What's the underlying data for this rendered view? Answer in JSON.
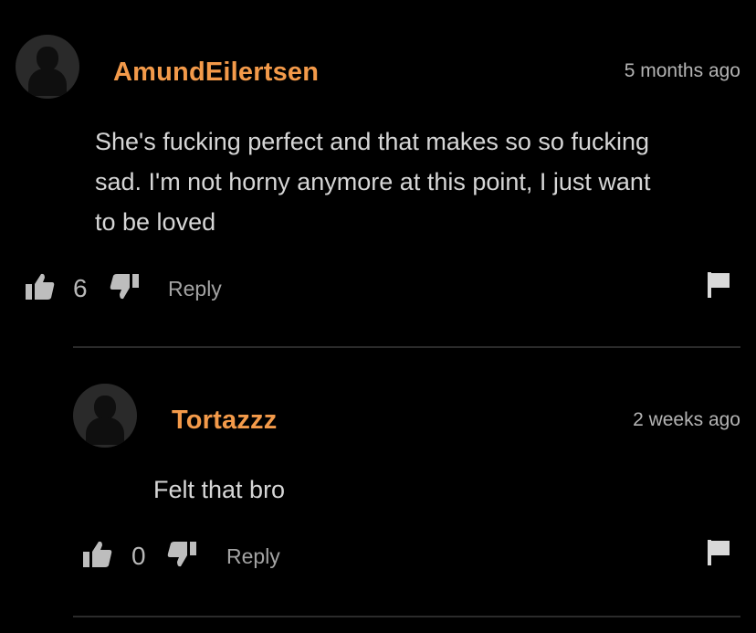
{
  "comments": [
    {
      "username": "AmundEilertsen",
      "timestamp": "5 months ago",
      "lines": [
        "She's fucking perfect and that makes so so fucking",
        "sad. I'm not horny anymore at this point, I just want",
        "to be loved"
      ],
      "likes": "6",
      "reply_label": "Reply"
    },
    {
      "username": "Tortazzz",
      "timestamp": "2 weeks ago",
      "lines": [
        "Felt that bro"
      ],
      "likes": "0",
      "reply_label": "Reply"
    }
  ],
  "icons": {
    "avatar": "default-user-avatar",
    "like": "thumbs-up-icon",
    "dislike": "thumbs-down-icon",
    "report": "flag-icon"
  },
  "colors": {
    "background": "#000000",
    "username": "#f39a4a",
    "text": "#d6d6d6",
    "muted": "#a3a3a3"
  }
}
